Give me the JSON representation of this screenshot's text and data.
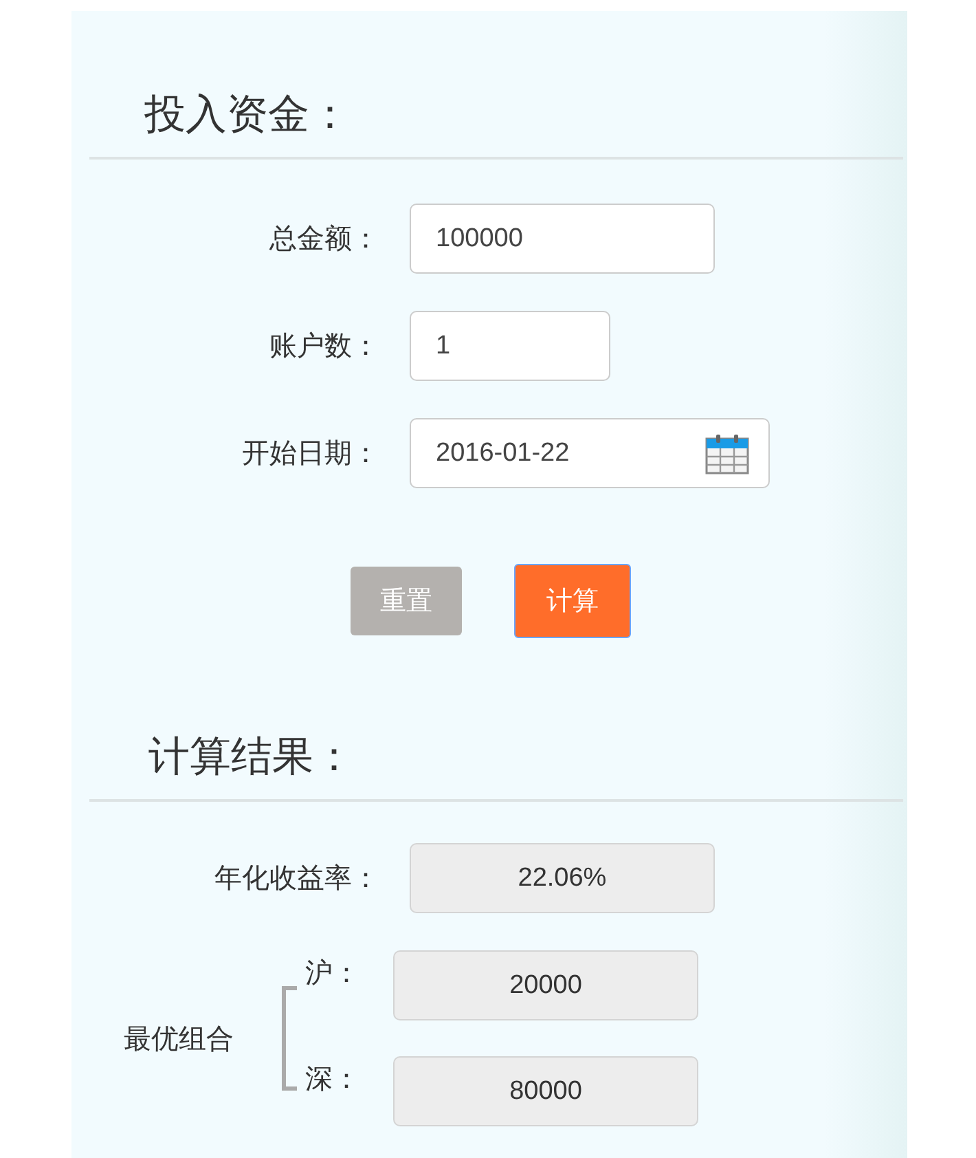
{
  "invest": {
    "heading": "投入资金：",
    "fields": [
      {
        "label": "总金额：",
        "value": "100000",
        "kind": "wide"
      },
      {
        "label": "账户数：",
        "value": "1",
        "kind": "short"
      },
      {
        "label": "开始日期：",
        "value": "2016-01-22",
        "kind": "date"
      }
    ],
    "buttons": [
      {
        "label": "重置",
        "kind": "reset"
      },
      {
        "label": "计算",
        "kind": "primary"
      }
    ]
  },
  "result": {
    "heading": "计算结果：",
    "rate": {
      "label": "年化收益率：",
      "value": "22.06%"
    },
    "combo": {
      "label": "最优组合",
      "items": [
        {
          "label": "沪：",
          "value": "20000"
        },
        {
          "label": "深：",
          "value": "80000"
        }
      ]
    }
  }
}
